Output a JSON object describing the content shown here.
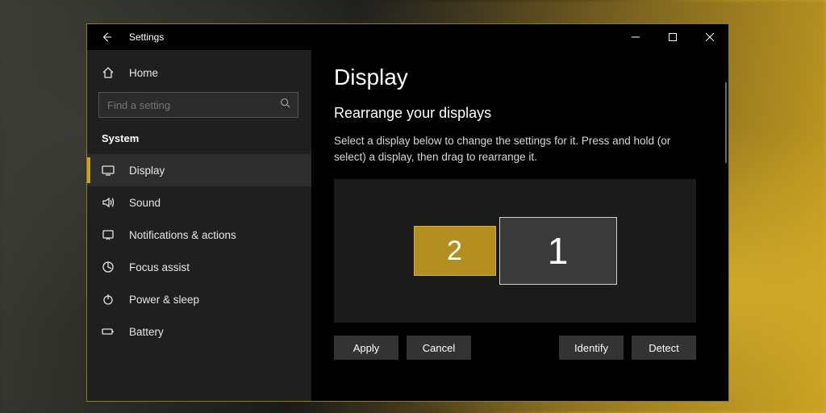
{
  "window": {
    "title": "Settings"
  },
  "sidebar": {
    "home": "Home",
    "search_placeholder": "Find a setting",
    "category": "System",
    "items": [
      {
        "label": "Display"
      },
      {
        "label": "Sound"
      },
      {
        "label": "Notifications & actions"
      },
      {
        "label": "Focus assist"
      },
      {
        "label": "Power & sleep"
      },
      {
        "label": "Battery"
      }
    ]
  },
  "main": {
    "title": "Display",
    "section_title": "Rearrange your displays",
    "section_desc": "Select a display below to change the settings for it. Press and hold (or select) a display, then drag to rearrange it.",
    "monitors": {
      "m1": "1",
      "m2": "2"
    },
    "buttons": {
      "apply": "Apply",
      "cancel": "Cancel",
      "identify": "Identify",
      "detect": "Detect"
    }
  }
}
